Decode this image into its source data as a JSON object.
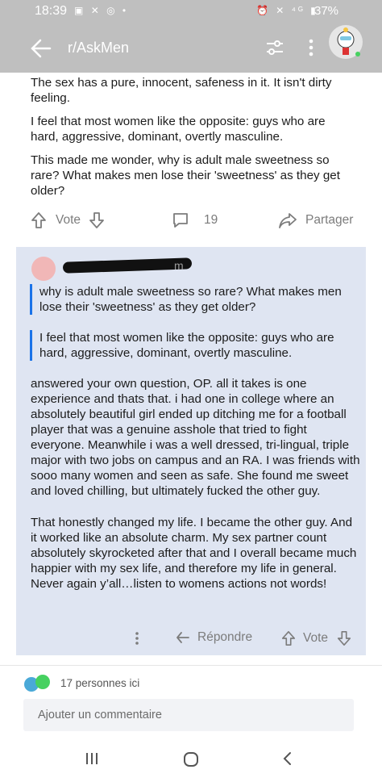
{
  "status_bar": {
    "time": "18:39",
    "left_icons": [
      "screenshot-icon",
      "sync-icon",
      "instagram-icon",
      "dot-icon"
    ],
    "right_icons": [
      "alarm-icon",
      "mute-icon",
      "4g-icon",
      "signal-icon"
    ],
    "battery": "37%"
  },
  "app_bar": {
    "title": "r/AskMen",
    "back_icon": "arrow-left-icon",
    "filter_icon": "sliders-icon",
    "more_icon": "kebab-icon",
    "avatar_icon": "snoo-avatar-icon"
  },
  "post": {
    "paragraphs": [
      "The sex has a pure, innocent, safeness in it. It isn't dirty feeling.",
      "I feel that most women like the opposite: guys who are hard, aggressive, dominant, overtly masculine.",
      "This made me wonder, why is adult male sweetness so rare? What makes men lose their 'sweetness' as they get older?"
    ],
    "actions": {
      "vote": "Vote",
      "comments": "19",
      "share": "Partager"
    }
  },
  "comment": {
    "age": "m",
    "quotes": [
      "why is adult male sweetness so rare? What makes men lose their 'sweetness' as they get older?",
      "I feel that most women like the opposite: guys who are hard, aggressive, dominant, overtly masculine."
    ],
    "body": [
      "answered your own question, OP. all it takes is one experience and thats that. i had one in college where an absolutely beautiful girl ended up ditching me for a football player that was a genuine asshole that tried to fight everyone. Meanwhile i was a well dressed, tri-lingual, triple major with two jobs on campus and an RA. I was friends with sooo many women and seen as safe. She found me sweet and loved chilling, but ultimately fucked the other guy.",
      "That honestly changed my life. I became the other guy. And it worked like an absolute charm. My sex partner count absolutely skyrocketed after that and I overall became much happier with my sex life, and therefore my life in general. Never again y’all…listen to womens actions not words!"
    ],
    "actions": {
      "reply": "Répondre",
      "vote": "Vote"
    }
  },
  "presence": {
    "text": "17 personnes ici"
  },
  "composer": {
    "placeholder": "Ajouter un commentaire"
  },
  "colors": {
    "app_bar": "#bfbfbf",
    "comment_bg": "#dfe5f2",
    "quote_bar": "#1a73e8",
    "muted_text": "#7c7c7c"
  }
}
